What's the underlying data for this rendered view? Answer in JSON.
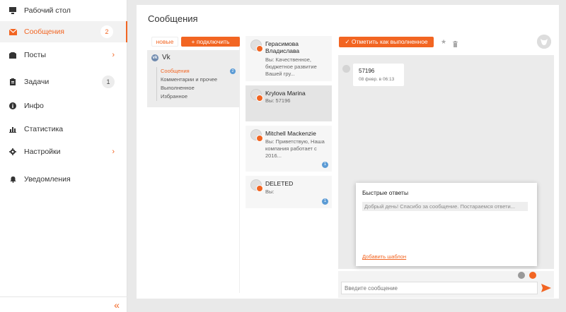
{
  "sidebar": {
    "items": [
      {
        "label": "Рабочий стол",
        "icon": "desktop-icon"
      },
      {
        "label": "Сообщения",
        "icon": "mail-icon",
        "badge": "2",
        "active": true
      },
      {
        "label": "Посты",
        "icon": "posts-icon",
        "chevron": "›"
      },
      {
        "label": "Задачи",
        "icon": "tasks-icon",
        "badge": "1"
      },
      {
        "label": "Инфо",
        "icon": "info-icon"
      },
      {
        "label": "Статистика",
        "icon": "stats-icon"
      },
      {
        "label": "Настройки",
        "icon": "gear-icon",
        "chevron": "›"
      },
      {
        "label": "Уведомления",
        "icon": "bell-icon"
      }
    ],
    "collapse_glyph": "«"
  },
  "main": {
    "title": "Сообщения",
    "tabs": {
      "new": "новые",
      "connect": "+ подключить"
    },
    "source": {
      "name": "Vk",
      "folders": [
        {
          "label": "Сообщения",
          "badge": "2",
          "active": true
        },
        {
          "label": "Комментарии и прочее"
        },
        {
          "label": "Выполненное"
        },
        {
          "label": "Избранное"
        }
      ]
    },
    "conversations": [
      {
        "name": "Герасимова Владислава",
        "preview": "Вы: Качественное, бюджетное развитие Вашей гру..."
      },
      {
        "name": "Krylova Marina",
        "preview": "Вы: 57196",
        "selected": true
      },
      {
        "name": "Mitchell Mackenzie",
        "preview": "Вы: Приветствую, Наша компания работает с 2016...",
        "badge": "1"
      },
      {
        "name": "DELETED",
        "preview": "Вы:",
        "badge": "1"
      }
    ],
    "chat": {
      "mark_done": "✓  Отметить как выполненное",
      "message": {
        "text": "57196",
        "time": "08 февр. в 06:13"
      },
      "quick_replies": {
        "title": "Быстрые ответы",
        "items": [
          "Добрый день! Спасибо за сообщение. Постараемся ответи..."
        ],
        "add_template": "Добавить шаблон"
      },
      "input_placeholder": "Введите сообщение"
    }
  },
  "colors": {
    "accent": "#f26522",
    "badge_blue": "#5b9bd5"
  }
}
